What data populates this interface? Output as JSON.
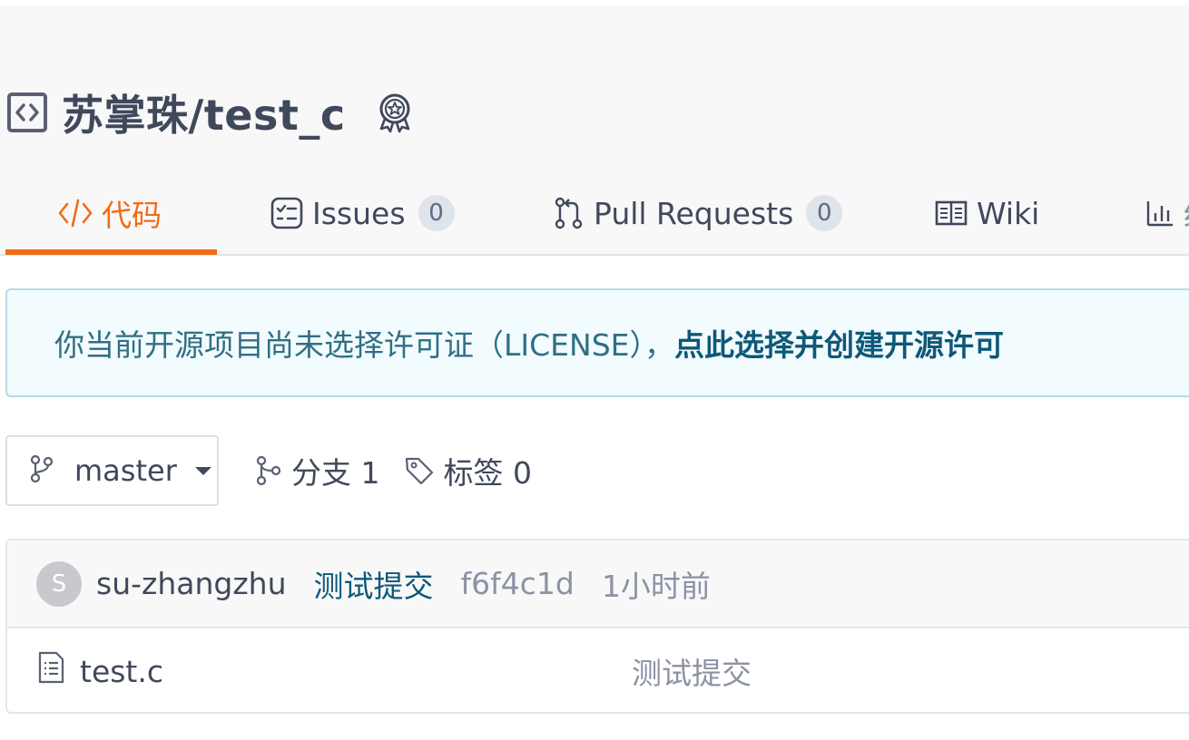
{
  "repo": {
    "title": "苏掌珠/test_c",
    "icon": "code-square-icon",
    "badge_icon": "award-icon"
  },
  "tabs": [
    {
      "label": "代码",
      "icon": "code-icon",
      "active": true
    },
    {
      "label": "Issues",
      "icon": "checklist-icon",
      "count": "0"
    },
    {
      "label": "Pull Requests",
      "icon": "pull-request-icon",
      "count": "0"
    },
    {
      "label": "Wiki",
      "icon": "book-icon"
    },
    {
      "label": "统",
      "icon": "bar-chart-icon"
    }
  ],
  "notice": {
    "text": "你当前开源项目尚未选择许可证（LICENSE），",
    "link": "点此选择并创建开源许可"
  },
  "branch": {
    "current": "master",
    "branches_label": "分支 1",
    "tags_label": "标签 0"
  },
  "latest_commit": {
    "avatar_letter": "S",
    "author": "su-zhangzhu",
    "message": "测试提交",
    "sha": "f6f4c1d",
    "time": "1小时前"
  },
  "files": [
    {
      "name": "test.c",
      "commit_message": "测试提交",
      "icon": "file-text-icon"
    }
  ],
  "colors": {
    "accent": "#f26b16",
    "link": "#0e5878",
    "notice_bg": "#f2fbfd",
    "notice_border": "#b7dbe6"
  }
}
